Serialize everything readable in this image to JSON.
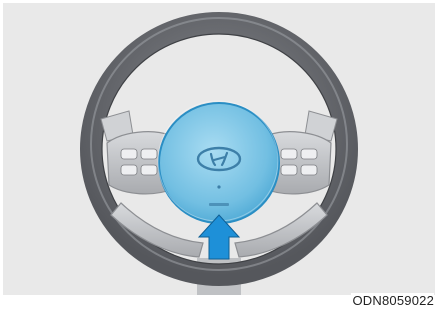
{
  "figure": {
    "code": "ODN8059022"
  },
  "colors": {
    "panel_bg": "#e9e9e9",
    "wheel_rim": "#6f7176",
    "wheel_rim_highlight": "#9a9ca1",
    "spoke": "#c8cacd",
    "airbag_fill": "#7ec6e6",
    "airbag_stroke": "#2a8ec4",
    "arrow": "#1e90d8"
  },
  "icons": {
    "arrow": "arrow-up-icon",
    "logo": "hyundai-logo-icon"
  }
}
